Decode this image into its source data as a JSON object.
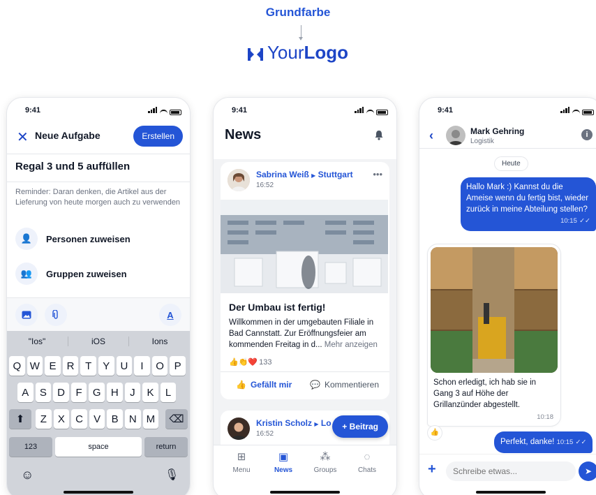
{
  "header": {
    "title": "Grundfarbe",
    "logo_regular": "Your",
    "logo_bold": "Logo"
  },
  "colors": {
    "primary": "#2455d6",
    "text": "#111827",
    "muted": "#6b7280"
  },
  "status": {
    "time": "9:41"
  },
  "task_screen": {
    "title": "Neue Aufgabe",
    "create_label": "Erstellen",
    "task_name": "Regal 3 und 5 auffüllen",
    "reminder": "Reminder: Daran denken, die Artikel aus der Lieferung von heute morgen auch zu verwenden",
    "assign_people": "Personen zuweisen",
    "assign_groups": "Gruppen zuweisen",
    "suggestions": [
      "\"Ios\"",
      "iOS",
      "Ions"
    ],
    "keys_row1": [
      "Q",
      "W",
      "E",
      "R",
      "T",
      "Y",
      "U",
      "I",
      "O",
      "P"
    ],
    "keys_row2": [
      "A",
      "S",
      "D",
      "F",
      "G",
      "H",
      "J",
      "K",
      "L"
    ],
    "keys_row3": [
      "Z",
      "X",
      "C",
      "V",
      "B",
      "N",
      "M"
    ],
    "key_123": "123",
    "key_space": "space",
    "key_return": "return"
  },
  "news_screen": {
    "title": "News",
    "post1": {
      "author": "Sabrina Weiß",
      "location": "Stuttgart",
      "time": "16:52",
      "title": "Der Umbau ist fertig!",
      "body": "Willkommen in der umgebauten Filiale in Bad Cannstatt. Zur Eröffnungsfeier am kommenden Freitag in d...",
      "more": "Mehr anzeigen",
      "reactions": "133",
      "like": "Gefällt mir",
      "comment": "Kommentieren"
    },
    "post2": {
      "author": "Kristin Scholz",
      "location": "Lo",
      "time": "16:52"
    },
    "fab_label": "Beitrag",
    "tabs": [
      {
        "label": "Menu",
        "icon": "grid-icon"
      },
      {
        "label": "News",
        "icon": "news-icon"
      },
      {
        "label": "Groups",
        "icon": "groups-icon"
      },
      {
        "label": "Chats",
        "icon": "chat-icon"
      }
    ]
  },
  "chat_screen": {
    "name": "Mark Gehring",
    "subtitle": "Logistik",
    "date_chip": "Heute",
    "msg1": "Hallo Mark :) Kannst du die Ameise wenn du fertig bist, wieder zurück in meine Abteilung stellen?",
    "msg1_time": "10:15",
    "msg2": "Schon erledigt, ich hab sie in Gang 3 auf Höhe der Grillanzünder abgestellt.",
    "msg2_time": "10:18",
    "msg3": "Perfekt, danke!",
    "msg3_time": "10:15",
    "input_placeholder": "Schreibe etwas..."
  }
}
